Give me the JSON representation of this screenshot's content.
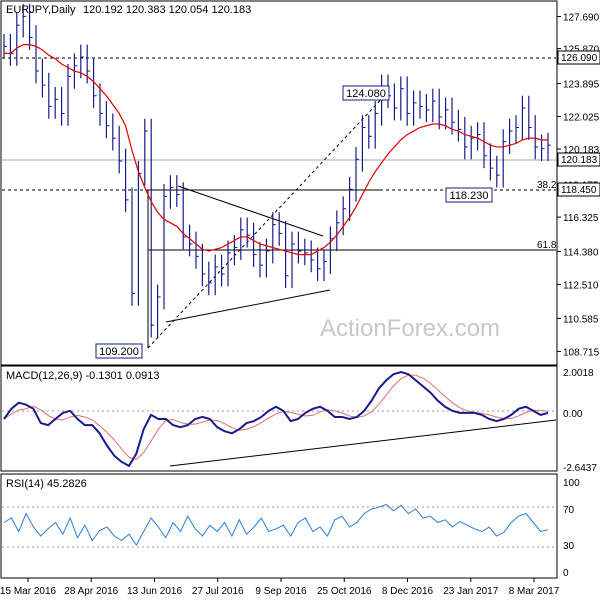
{
  "header": {
    "symbol": "EURJPY,Daily",
    "ohlc": "120.192 120.383 120.054 120.183"
  },
  "watermark": "ActionForex.com",
  "colors": {
    "price_bar": "#1a1a8c",
    "sma": "#e00000",
    "macd_line": "#1a1a8c",
    "macd_signal": "#e07070",
    "rsi": "#2a7fd4",
    "trendline": "#000000",
    "grid_dotted": "#999999",
    "axis": "#000000",
    "watermark": "#c8c8c8"
  },
  "price_panel": {
    "y_ticks": [
      "127.690",
      "125.870",
      "123.895",
      "122.025",
      "120.183",
      "118.175",
      "116.325",
      "114.380",
      "112.510",
      "110.585",
      "108.715"
    ],
    "current_price_label": "120.183",
    "resistance_label": "126.090",
    "support_label": "118.450",
    "fib_382_label": "38.2",
    "fib_618_label": "61.8",
    "callout_high": "124.080",
    "callout_low": "109.200",
    "callout_pullback": "118.230"
  },
  "macd_panel": {
    "title": "MACD(12,26,9) -0.1301 0.0913",
    "y_ticks": [
      "2.0018",
      "0.00",
      "-2.6437"
    ]
  },
  "rsi_panel": {
    "title": "RSI(14) 45.2826",
    "y_ticks": [
      "100",
      "70",
      "30",
      "0"
    ]
  },
  "x_axis": {
    "labels": [
      "15 Mar 2016",
      "28 Apr 2016",
      "13 Jun 2016",
      "27 Jul 2016",
      "9 Sep 2016",
      "25 Oct 2016",
      "8 Dec 2016",
      "23 Jan 2017",
      "8 Mar 2017"
    ]
  },
  "chart_data": [
    {
      "type": "ohlc",
      "title": "EURJPY,Daily",
      "y_range": [
        108.0,
        128.4
      ],
      "series": [
        {
          "name": "EURJPY",
          "values": [
            126.0,
            125.6,
            127.2,
            127.7,
            126.5,
            124.6,
            123.8,
            122.6,
            123.0,
            122.2,
            124.3,
            124.9,
            125.4,
            124.6,
            123.2,
            122.2,
            121.5,
            120.8,
            119.5,
            117.3,
            112.0,
            118.8,
            121.2,
            110.2,
            111.8,
            117.5,
            118.0,
            117.6,
            115.2,
            114.8,
            114.1,
            113.1,
            112.6,
            113.5,
            113.1,
            114.3,
            114.6,
            115.6,
            115.3,
            114.2,
            113.6,
            114.4,
            115.9,
            115.4,
            113.0,
            114.8,
            114.4,
            114.3,
            113.9,
            113.4,
            113.8,
            115.1,
            116.0,
            116.8,
            117.9,
            119.6,
            121.4,
            120.9,
            122.2,
            123.7,
            123.2,
            122.5,
            123.6,
            122.2,
            122.8,
            122.6,
            122.4,
            122.9,
            122.0,
            122.4,
            121.7,
            121.3,
            120.3,
            120.8,
            121.0,
            119.8,
            119.1,
            118.7,
            120.6,
            121.2,
            121.4,
            122.5,
            121.4,
            120.3,
            120.2,
            120.4
          ]
        },
        {
          "name": "SMA",
          "values": [
            125.6,
            125.6,
            125.9,
            126.1,
            126.1,
            126.0,
            125.8,
            125.5,
            125.3,
            125.0,
            124.8,
            124.6,
            124.5,
            124.3,
            124.0,
            123.6,
            123.2,
            122.7,
            122.2,
            121.5,
            120.1,
            118.9,
            118.0,
            117.2,
            116.6,
            116.2,
            116.0,
            115.8,
            115.4,
            115.1,
            114.8,
            114.5,
            114.4,
            114.5,
            114.6,
            114.8,
            115.0,
            115.2,
            115.2,
            115.0,
            114.8,
            114.7,
            114.6,
            114.5,
            114.4,
            114.3,
            114.2,
            114.2,
            114.2,
            114.4,
            114.6,
            114.9,
            115.3,
            115.8,
            116.3,
            116.9,
            117.6,
            118.3,
            118.9,
            119.4,
            119.9,
            120.3,
            120.7,
            121.0,
            121.2,
            121.4,
            121.5,
            121.6,
            121.6,
            121.5,
            121.3,
            121.2,
            121.0,
            120.9,
            120.8,
            120.6,
            120.4,
            120.3,
            120.3,
            120.4,
            120.5,
            120.7,
            120.8,
            120.8,
            120.7,
            120.7
          ]
        }
      ],
      "annotations": [
        "124.080",
        "109.200",
        "118.230",
        "126.090",
        "118.450",
        "38.2",
        "61.8"
      ]
    },
    {
      "type": "line",
      "title": "MACD(12,26,9) -0.1301 0.0913",
      "y_range": [
        -2.8,
        2.2
      ],
      "series": [
        {
          "name": "MACD",
          "values": [
            -0.3,
            0.2,
            0.5,
            0.4,
            0.2,
            -0.5,
            -0.6,
            -0.3,
            0.0,
            0.1,
            -0.3,
            -0.6,
            -0.6,
            -1.0,
            -1.6,
            -2.1,
            -2.4,
            -2.6,
            -2.0,
            -0.8,
            -0.1,
            -0.3,
            -0.3,
            -0.6,
            -0.7,
            -0.6,
            -0.3,
            -0.2,
            -0.3,
            -0.7,
            -0.9,
            -1.0,
            -0.8,
            -0.5,
            -0.4,
            -0.2,
            0.1,
            0.3,
            0.1,
            -0.4,
            -0.3,
            0.0,
            0.2,
            0.3,
            0.1,
            -0.2,
            -0.2,
            -0.3,
            -0.2,
            0.1,
            0.6,
            1.2,
            1.6,
            1.9,
            2.0,
            1.9,
            1.6,
            1.3,
            1.0,
            0.6,
            0.3,
            0.1,
            0.0,
            0.0,
            0.0,
            -0.1,
            -0.3,
            -0.4,
            -0.3,
            -0.1,
            0.2,
            0.3,
            0.1,
            -0.1,
            0.0
          ]
        }
      ]
    },
    {
      "type": "line",
      "title": "RSI(14) 45.2826",
      "y_range": [
        0,
        100
      ],
      "series": [
        {
          "name": "RSI",
          "values": [
            55,
            60,
            45,
            65,
            50,
            40,
            48,
            55,
            42,
            60,
            38,
            52,
            35,
            46,
            50,
            40,
            35,
            42,
            30,
            45,
            60,
            50,
            38,
            55,
            45,
            62,
            48,
            40,
            52,
            45,
            55,
            40,
            58,
            42,
            50,
            60,
            45,
            48,
            52,
            40,
            55,
            60,
            45,
            50,
            40,
            58,
            62,
            50,
            55,
            65,
            70,
            72,
            75,
            68,
            74,
            65,
            70,
            60,
            62,
            55,
            58,
            50,
            56,
            52,
            48,
            45,
            50,
            40,
            44,
            55,
            62,
            65,
            55,
            45,
            47
          ]
        }
      ]
    }
  ]
}
